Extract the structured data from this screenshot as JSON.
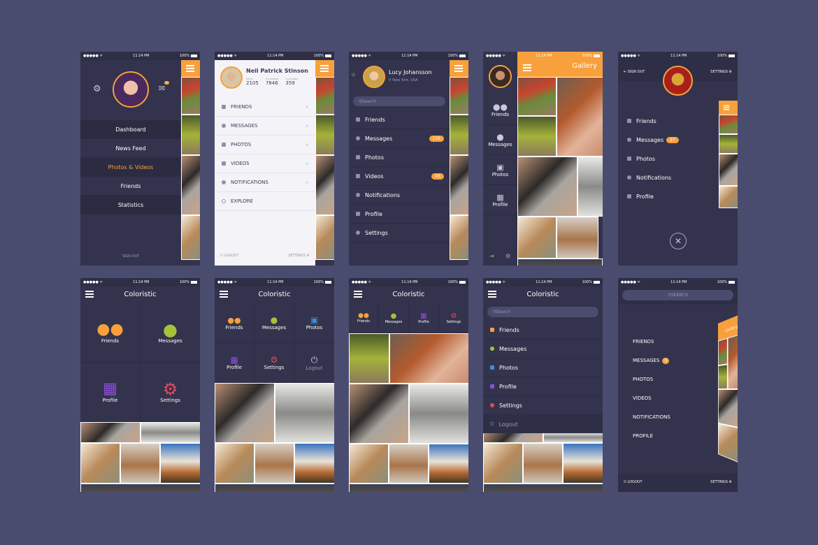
{
  "status": {
    "carrier": "●●●●● ᯤ",
    "time": "11:14 PM",
    "battery": "100%"
  },
  "colors": {
    "background": "#4a4c6f",
    "panel": "#33334d",
    "accent": "#f7a03c",
    "messages": "#a5c23a",
    "profile": "#8b4fd6",
    "settings": "#e84a5a",
    "photos": "#3b8fe0"
  },
  "s1": {
    "menu": [
      "Dashboard",
      "News Feed",
      "Photos & Videos",
      "Friends",
      "Statistics"
    ],
    "active": "Photos & Videos",
    "mail_badge": "1",
    "sign_out": "SIGN OUT"
  },
  "s2": {
    "name": "Neil Patrick Stinson",
    "stats": [
      {
        "label": "POSTS",
        "value": "2105"
      },
      {
        "label": "FOLLOWERS",
        "value": "7846"
      },
      {
        "label": "FOLLOWING",
        "value": "359"
      }
    ],
    "menu": [
      "FRIENDS",
      "MESSAGES",
      "PHOTOS",
      "VIDEOS",
      "NOTIFICATIONS",
      "EXPLORE"
    ],
    "logout": "LOGOUT",
    "settings": "SETTINGS"
  },
  "s3": {
    "name": "Lucy Johansson",
    "location": "New York, USA",
    "search_placeholder": "Search",
    "menu": [
      "Friends",
      "Messages",
      "Photos",
      "Videos",
      "Notifications",
      "Profile",
      "Settings"
    ],
    "messages_badge": "126",
    "videos_badge": "43"
  },
  "s4": {
    "title": "Gallery",
    "nav": [
      "Friends",
      "Messages",
      "Photos",
      "Profile"
    ]
  },
  "s5": {
    "sign_out": "SIGN OUT",
    "settings": "SETTINGS",
    "menu": [
      "Friends",
      "Messages",
      "Photos",
      "Notifications",
      "Profile"
    ],
    "messages_badge": "27"
  },
  "s6": {
    "title": "Coloristic",
    "tiles": [
      "Friends",
      "Messages",
      "Profile",
      "Settings"
    ]
  },
  "s7": {
    "title": "Coloristic",
    "tiles": [
      "Friends",
      "Messages",
      "Photos",
      "Profile",
      "Settings",
      "Logout"
    ]
  },
  "s8": {
    "title": "Coloristic",
    "tiles": [
      "Friends",
      "Messages",
      "Profile",
      "Settings"
    ]
  },
  "s9": {
    "title": "Coloristic",
    "search_placeholder": "Search",
    "menu": [
      "Friends",
      "Messages",
      "Photos",
      "Profile",
      "Settings",
      "Logout"
    ]
  },
  "s10": {
    "search_placeholder": "SEARCH",
    "menu": [
      "FRIENDS",
      "MESSAGES",
      "PHOTOS",
      "VIDEOS",
      "NOTIFICATIONS",
      "PROFILE"
    ],
    "messages_badge": "5",
    "logout": "LOGOUT",
    "settings": "SETTINGS",
    "preview_title": "Gallery"
  }
}
